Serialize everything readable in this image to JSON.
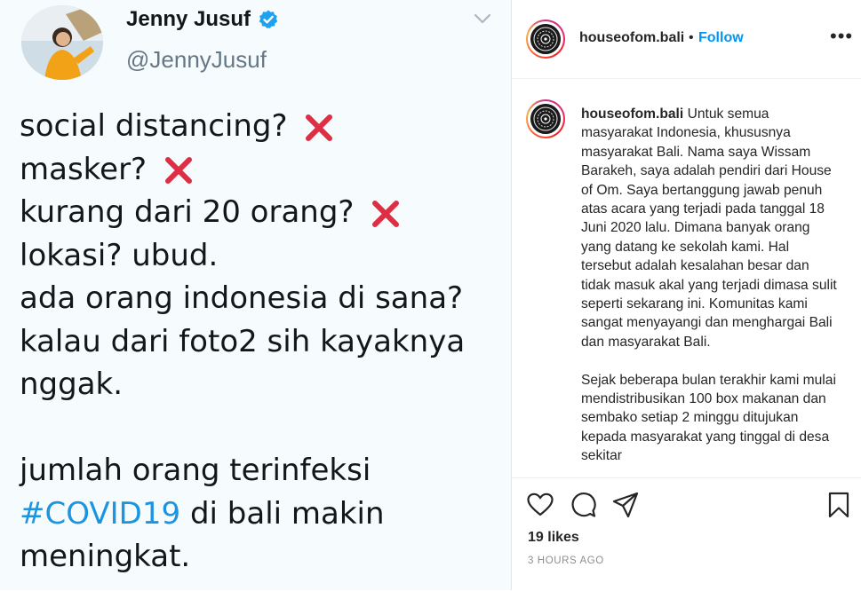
{
  "tweet": {
    "author_name": "Jenny Jusuf",
    "author_handle": "@JennyJusuf",
    "lines": [
      "social distancing?",
      "masker?",
      "kurang dari 20 orang?",
      "lokasi? ubud.",
      "ada orang indonesia di sana?",
      "kalau dari foto2 sih kayaknya",
      "nggak.",
      "jumlah orang terinfeksi",
      "#COVID19",
      "di bali makin",
      "meningkat."
    ],
    "icons": {
      "verified": "verified-badge-icon",
      "options": "chevron-down-icon",
      "cross": "cross-mark-icon"
    },
    "colors": {
      "hashtag": "#1b95e0",
      "cross": "#dd2e44",
      "verified": "#1da1f2"
    }
  },
  "instagram": {
    "username": "houseofom.bali",
    "separator": "•",
    "follow_label": "Follow",
    "more_label": "•••",
    "caption_username": "houseofom.bali",
    "caption_para1": "Untuk semua masyarakat Indonesia, khususnya masyarakat Bali. Nama saya Wissam Barakeh, saya adalah pendiri dari House of Om. Saya bertanggung jawab penuh atas acara yang terjadi pada tanggal 18 Juni 2020 lalu. Dimana banyak orang yang datang ke sekolah kami. Hal tersebut adalah kesalahan besar dan tidak masuk akal yang terjadi dimasa sulit seperti sekarang ini. Komunitas kami sangat menyayangi dan menghargai Bali dan masyarakat Bali.",
    "caption_para2": "Sejak beberapa bulan terakhir kami mulai mendistribusikan 100 box makanan dan sembako setiap 2 minggu ditujukan kepada masyarakat yang tinggal di desa sekitar",
    "likes": "19 likes",
    "timestamp": "3 HOURS AGO",
    "icons": [
      "heart-icon",
      "comment-icon",
      "share-icon",
      "bookmark-icon"
    ],
    "colors": {
      "follow": "#0095f6",
      "text": "#262626",
      "muted": "#8e8e8e"
    }
  }
}
